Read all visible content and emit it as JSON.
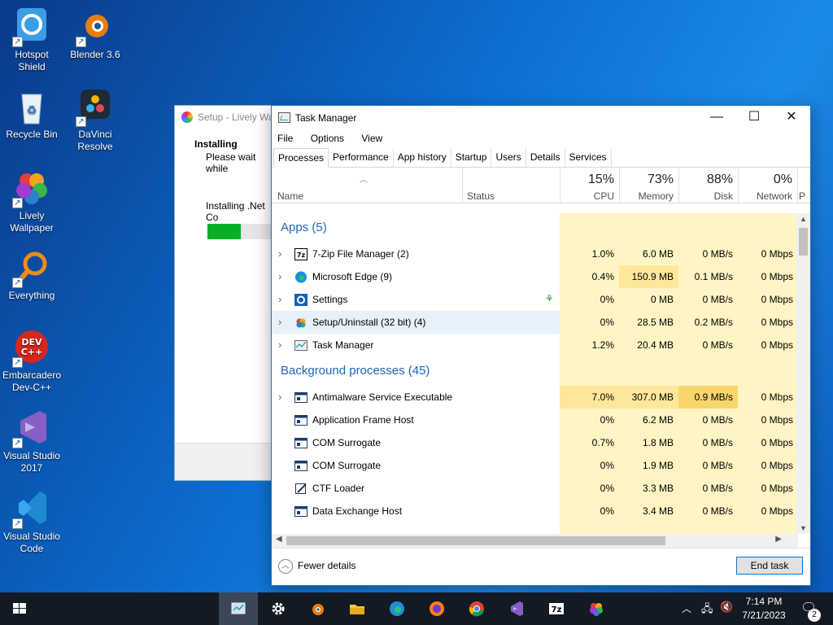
{
  "desktop_icons": [
    {
      "label": "Hotspot\nShield",
      "icon": "hotspot-shield-icon"
    },
    {
      "label": "Blender 3.6",
      "icon": "blender-icon"
    },
    {
      "label": "Recycle Bin",
      "icon": "recycle-bin-icon"
    },
    {
      "label": "DaVinci\nResolve",
      "icon": "davinci-resolve-icon"
    },
    {
      "label": "Lively\nWallpaper",
      "icon": "lively-wallpaper-icon"
    },
    {
      "label": "Everything",
      "icon": "everything-search-icon"
    },
    {
      "label": "Embarcadero\nDev-C++",
      "icon": "devcpp-icon"
    },
    {
      "label": "Visual Studio\n2017",
      "icon": "visual-studio-icon"
    },
    {
      "label": "Visual Studio\nCode",
      "icon": "vscode-icon"
    }
  ],
  "setup_window": {
    "title": "Setup - Lively Wa",
    "heading": "Installing",
    "subtext": "Please wait while",
    "status": "Installing .Net Co",
    "progress": 0.45
  },
  "task_manager": {
    "title": "Task Manager",
    "menu": [
      "File",
      "Options",
      "View"
    ],
    "tabs": [
      "Processes",
      "Performance",
      "App history",
      "Startup",
      "Users",
      "Details",
      "Services"
    ],
    "active_tab": "Processes",
    "columns": {
      "name": "Name",
      "status": "Status",
      "cpu": {
        "pct": "15%",
        "label": "CPU"
      },
      "memory": {
        "pct": "73%",
        "label": "Memory"
      },
      "disk": {
        "pct": "88%",
        "label": "Disk"
      },
      "network": {
        "pct": "0%",
        "label": "Network"
      },
      "next": "P"
    },
    "apps_group": "Apps (5)",
    "apps": [
      {
        "name": "7-Zip File Manager (2)",
        "cpu": "1.0%",
        "memory": "6.0 MB",
        "disk": "0 MB/s",
        "network": "0 Mbps",
        "icon": "7zip-icon",
        "expand": true
      },
      {
        "name": "Microsoft Edge (9)",
        "cpu": "0.4%",
        "memory": "150.9 MB",
        "disk": "0.1 MB/s",
        "network": "0 Mbps",
        "icon": "edge-icon",
        "expand": true
      },
      {
        "name": "Settings",
        "cpu": "0%",
        "memory": "0 MB",
        "disk": "0 MB/s",
        "network": "0 Mbps",
        "icon": "settings-gear-icon",
        "expand": true,
        "leaf": true
      },
      {
        "name": "Setup/Uninstall (32 bit) (4)",
        "cpu": "0%",
        "memory": "28.5 MB",
        "disk": "0.2 MB/s",
        "network": "0 Mbps",
        "icon": "setup-icon",
        "expand": true,
        "highlight": true
      },
      {
        "name": "Task Manager",
        "cpu": "1.2%",
        "memory": "20.4 MB",
        "disk": "0 MB/s",
        "network": "0 Mbps",
        "icon": "task-manager-icon",
        "expand": true
      }
    ],
    "bg_group": "Background processes (45)",
    "background": [
      {
        "name": "Antimalware Service Executable",
        "cpu": "7.0%",
        "memory": "307.0 MB",
        "disk": "0.9 MB/s",
        "network": "0 Mbps",
        "icon": "process-icon",
        "expand": true
      },
      {
        "name": "Application Frame Host",
        "cpu": "0%",
        "memory": "6.2 MB",
        "disk": "0 MB/s",
        "network": "0 Mbps",
        "icon": "process-icon"
      },
      {
        "name": "COM Surrogate",
        "cpu": "0.7%",
        "memory": "1.8 MB",
        "disk": "0 MB/s",
        "network": "0 Mbps",
        "icon": "process-icon"
      },
      {
        "name": "COM Surrogate",
        "cpu": "0%",
        "memory": "1.9 MB",
        "disk": "0 MB/s",
        "network": "0 Mbps",
        "icon": "process-icon"
      },
      {
        "name": "CTF Loader",
        "cpu": "0%",
        "memory": "3.3 MB",
        "disk": "0 MB/s",
        "network": "0 Mbps",
        "icon": "ctf-loader-icon"
      },
      {
        "name": "Data Exchange Host",
        "cpu": "0%",
        "memory": "3.4 MB",
        "disk": "0 MB/s",
        "network": "0 Mbps",
        "icon": "process-icon"
      }
    ],
    "fewer_details": "Fewer details",
    "end_task": "End task"
  },
  "taskbar": {
    "items": [
      "task-manager-icon",
      "settings-gear-icon",
      "blender-icon",
      "file-explorer-icon",
      "edge-icon",
      "firefox-icon",
      "chrome-icon",
      "visual-studio-icon",
      "7zip-icon",
      "lively-wallpaper-icon"
    ],
    "time": "7:14 PM",
    "date": "7/21/2023",
    "notifications": "2"
  },
  "colors": {
    "accent": "#0078d7",
    "group_text": "#1e64b4",
    "heat_light": "#fff4c4",
    "heat_mid": "#ffe79a",
    "heat_high": "#f9d66a"
  }
}
